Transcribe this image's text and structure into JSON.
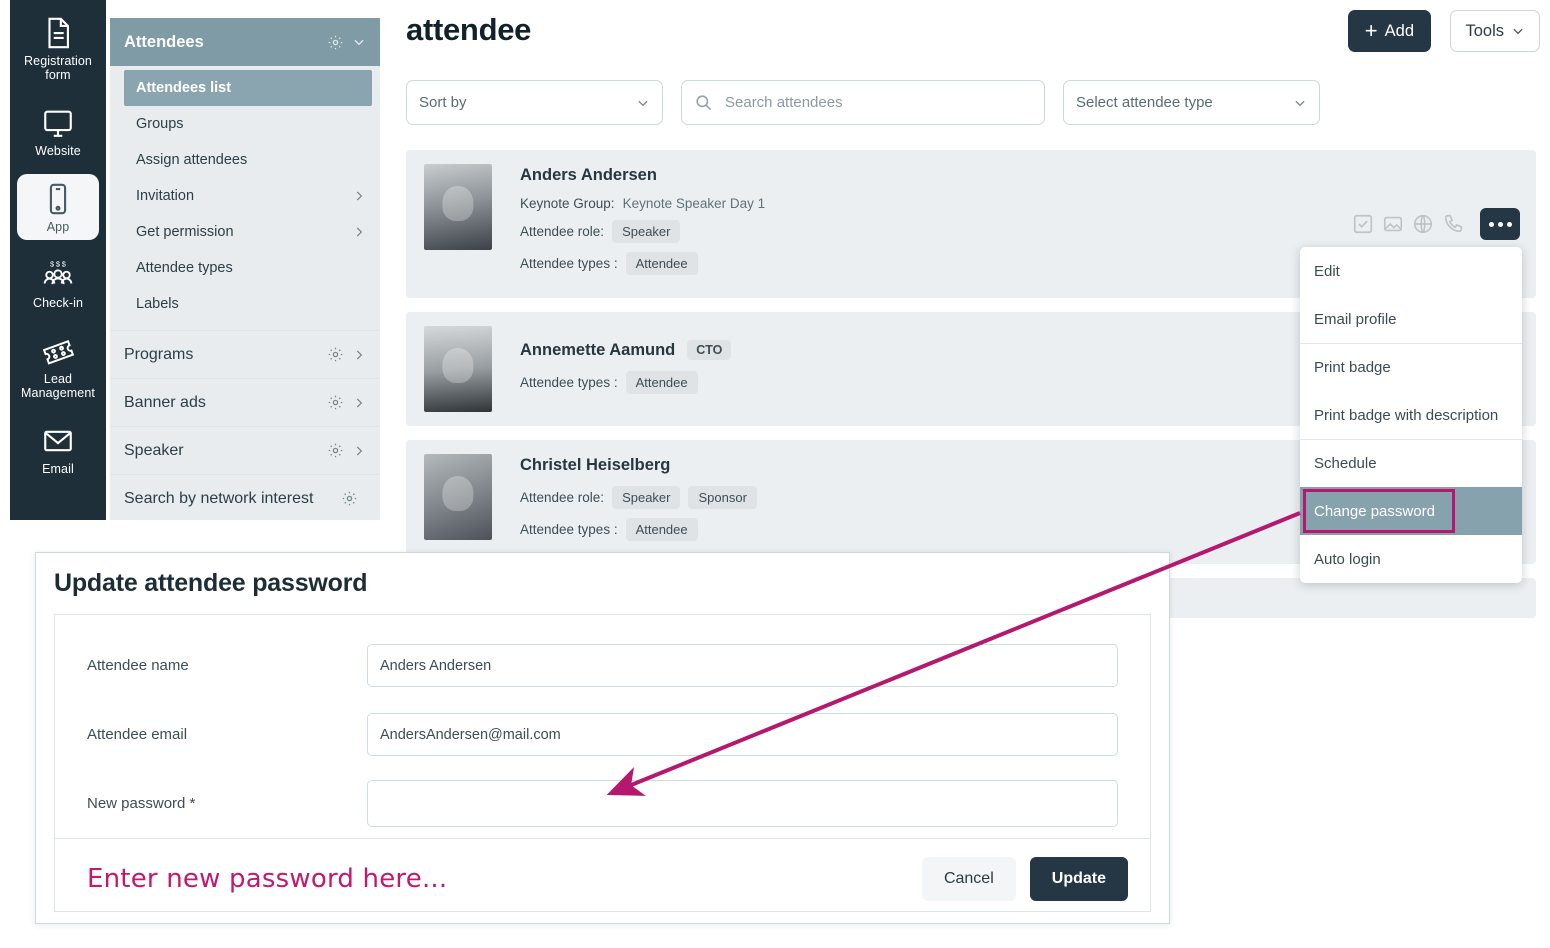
{
  "rail": {
    "items": [
      {
        "label": "Registration form",
        "icon": "document-icon",
        "active": false
      },
      {
        "label": "Website",
        "icon": "monitor-icon",
        "active": false
      },
      {
        "label": "App",
        "icon": "mobile-icon",
        "active": true
      },
      {
        "label": "Check-in",
        "icon": "people-money-icon",
        "active": false
      },
      {
        "label": "Lead Management",
        "icon": "ticket-icon",
        "active": false
      },
      {
        "label": "Email",
        "icon": "envelope-icon",
        "active": false
      }
    ]
  },
  "nav": {
    "header": "Attendees",
    "subitems": [
      {
        "label": "Attendees list",
        "active": true,
        "chevron": false
      },
      {
        "label": "Groups",
        "active": false,
        "chevron": false
      },
      {
        "label": "Assign attendees",
        "active": false,
        "chevron": false
      },
      {
        "label": "Invitation",
        "active": false,
        "chevron": true
      },
      {
        "label": "Get permission",
        "active": false,
        "chevron": true
      },
      {
        "label": "Attendee types",
        "active": false,
        "chevron": false
      },
      {
        "label": "Labels",
        "active": false,
        "chevron": false
      }
    ],
    "groups": [
      {
        "label": "Programs",
        "gear": true,
        "chevron": true
      },
      {
        "label": "Banner ads",
        "gear": true,
        "chevron": true
      },
      {
        "label": "Speaker",
        "gear": true,
        "chevron": true
      },
      {
        "label": "Search by network interest",
        "gear": true,
        "chevron": false
      }
    ]
  },
  "header": {
    "title": "attendee",
    "add_label": "Add",
    "tools_label": "Tools"
  },
  "filters": {
    "sort_label": "Sort by",
    "search_placeholder": "Search attendees",
    "type_label": "Select attendee type"
  },
  "attendees": [
    {
      "name": "Anders Andersen",
      "title_badge": "",
      "group_label": "Keynote Group:",
      "group_value": "Keynote Speaker Day 1",
      "role_label": "Attendee role:",
      "roles": [
        "Speaker"
      ],
      "types_label": "Attendee types :",
      "types": [
        "Attendee"
      ]
    },
    {
      "name": "Annemette Aamund",
      "title_badge": "CTO",
      "group_label": "",
      "group_value": "",
      "role_label": "",
      "roles": [],
      "types_label": "Attendee types :",
      "types": [
        "Attendee"
      ]
    },
    {
      "name": "Christel Heiselberg",
      "title_badge": "",
      "group_label": "",
      "group_value": "",
      "role_label": "Attendee role:",
      "roles": [
        "Speaker",
        "Sponsor"
      ],
      "types_label": "Attendee types :",
      "types": [
        "Attendee"
      ]
    }
  ],
  "card_actions": {
    "icons": [
      "checkbox-icon",
      "image-icon",
      "globe-icon",
      "phone-icon"
    ],
    "more_label": "more-actions"
  },
  "menu": {
    "items": [
      {
        "label": "Edit",
        "separator": false,
        "highlighted": false
      },
      {
        "label": "Email profile",
        "separator": false,
        "highlighted": false
      },
      {
        "label": "Print badge",
        "separator": true,
        "highlighted": false
      },
      {
        "label": "Print badge with description",
        "separator": false,
        "highlighted": false
      },
      {
        "label": "Schedule",
        "separator": true,
        "highlighted": false
      },
      {
        "label": "Change password",
        "separator": false,
        "highlighted": true
      },
      {
        "label": "Auto login",
        "separator": false,
        "highlighted": false
      }
    ]
  },
  "modal": {
    "title": "Update attendee password",
    "fields": [
      {
        "label": "Attendee name",
        "value": "Anders Andersen"
      },
      {
        "label": "Attendee email",
        "value": "AndersAndersen@mail.com"
      },
      {
        "label": "New password *",
        "value": ""
      }
    ],
    "hint": "Enter new password here...",
    "cancel_label": "Cancel",
    "update_label": "Update"
  },
  "colors": {
    "accent_dark": "#253744",
    "nav_header": "#7e9ba6",
    "menu_highlight": "#85a2ad",
    "annotation": "#b4186f",
    "card_bg": "#eceff1"
  }
}
